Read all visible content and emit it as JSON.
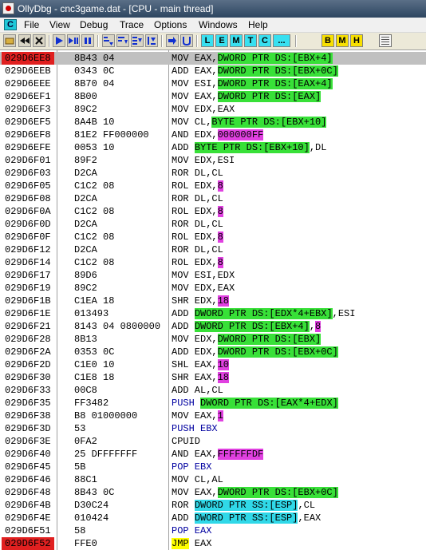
{
  "window": {
    "title": "OllyDbg - cnc3game.dat - [CPU - main thread]"
  },
  "menubar": {
    "sys_icon": "C",
    "items": [
      "File",
      "View",
      "Debug",
      "Trace",
      "Options",
      "Windows",
      "Help"
    ]
  },
  "toolbar": {
    "letter_buttons": [
      "L",
      "E",
      "M",
      "T",
      "C",
      "...",
      "B",
      "M",
      "H"
    ],
    "icons": [
      "open-icon",
      "rewind-icon",
      "close-icon",
      "run-icon",
      "pause-icon",
      "step-into-icon",
      "step-over-icon",
      "trace-into-icon",
      "trace-over-icon",
      "execute-till-return-icon",
      "go-to-user-code-icon",
      "grid-icon"
    ]
  },
  "colors": {
    "memory_operand": "#38e038",
    "immediate_operand": "#e040e0",
    "stack_operand": "#30d8e8",
    "breakpoint_address": "#e02020",
    "selected_row": "#c0c0c0",
    "jump_mnemonic": "#ffff00"
  },
  "disassembly": {
    "rows": [
      {
        "addr": "029D6EE8",
        "hex": "8B43 04",
        "state": "bp-selected",
        "ins": [
          {
            "t": "MOV EAX,"
          },
          {
            "t": "DWORD PTR DS:[EBX+4]",
            "c": "mem"
          }
        ]
      },
      {
        "addr": "029D6EEB",
        "hex": "0343 0C",
        "ins": [
          {
            "t": "ADD EAX,"
          },
          {
            "t": "DWORD PTR DS:[EBX+0C]",
            "c": "mem"
          }
        ]
      },
      {
        "addr": "029D6EEE",
        "hex": "8B70 04",
        "ins": [
          {
            "t": "MOV ESI,"
          },
          {
            "t": "DWORD PTR DS:[EAX+4]",
            "c": "mem"
          }
        ]
      },
      {
        "addr": "029D6EF1",
        "hex": "8B00",
        "ins": [
          {
            "t": "MOV EAX,"
          },
          {
            "t": "DWORD PTR DS:[EAX]",
            "c": "mem"
          }
        ]
      },
      {
        "addr": "029D6EF3",
        "hex": "89C2",
        "ins": [
          {
            "t": "MOV EDX,EAX"
          }
        ]
      },
      {
        "addr": "029D6EF5",
        "hex": "8A4B 10",
        "ins": [
          {
            "t": "MOV CL,"
          },
          {
            "t": "BYTE PTR DS:[EBX+10]",
            "c": "mem"
          }
        ]
      },
      {
        "addr": "029D6EF8",
        "hex": "81E2 FF000000",
        "ins": [
          {
            "t": "AND EDX,"
          },
          {
            "t": "000000FF",
            "c": "imm"
          }
        ]
      },
      {
        "addr": "029D6EFE",
        "hex": "0053 10",
        "ins": [
          {
            "t": "ADD "
          },
          {
            "t": "BYTE PTR DS:[EBX+10]",
            "c": "mem"
          },
          {
            "t": ",DL"
          }
        ]
      },
      {
        "addr": "029D6F01",
        "hex": "89F2",
        "ins": [
          {
            "t": "MOV EDX,ESI"
          }
        ]
      },
      {
        "addr": "029D6F03",
        "hex": "D2CA",
        "ins": [
          {
            "t": "ROR DL,CL"
          }
        ]
      },
      {
        "addr": "029D6F05",
        "hex": "C1C2 08",
        "ins": [
          {
            "t": "ROL EDX,"
          },
          {
            "t": "8",
            "c": "imm"
          }
        ]
      },
      {
        "addr": "029D6F08",
        "hex": "D2CA",
        "ins": [
          {
            "t": "ROR DL,CL"
          }
        ]
      },
      {
        "addr": "029D6F0A",
        "hex": "C1C2 08",
        "ins": [
          {
            "t": "ROL EDX,"
          },
          {
            "t": "8",
            "c": "imm"
          }
        ]
      },
      {
        "addr": "029D6F0D",
        "hex": "D2CA",
        "ins": [
          {
            "t": "ROR DL,CL"
          }
        ]
      },
      {
        "addr": "029D6F0F",
        "hex": "C1C2 08",
        "ins": [
          {
            "t": "ROL EDX,"
          },
          {
            "t": "8",
            "c": "imm"
          }
        ]
      },
      {
        "addr": "029D6F12",
        "hex": "D2CA",
        "ins": [
          {
            "t": "ROR DL,CL"
          }
        ]
      },
      {
        "addr": "029D6F14",
        "hex": "C1C2 08",
        "ins": [
          {
            "t": "ROL EDX,"
          },
          {
            "t": "8",
            "c": "imm"
          }
        ]
      },
      {
        "addr": "029D6F17",
        "hex": "89D6",
        "ins": [
          {
            "t": "MOV ESI,EDX"
          }
        ]
      },
      {
        "addr": "029D6F19",
        "hex": "89C2",
        "ins": [
          {
            "t": "MOV EDX,EAX"
          }
        ]
      },
      {
        "addr": "029D6F1B",
        "hex": "C1EA 18",
        "ins": [
          {
            "t": "SHR EDX,"
          },
          {
            "t": "18",
            "c": "imm"
          }
        ]
      },
      {
        "addr": "029D6F1E",
        "hex": "013493",
        "ins": [
          {
            "t": "ADD "
          },
          {
            "t": "DWORD PTR DS:[EDX*4+EBX]",
            "c": "mem"
          },
          {
            "t": ",ESI"
          }
        ]
      },
      {
        "addr": "029D6F21",
        "hex": "8143 04 0800000",
        "ins": [
          {
            "t": "ADD "
          },
          {
            "t": "DWORD PTR DS:[EBX+4]",
            "c": "mem"
          },
          {
            "t": ","
          },
          {
            "t": "8",
            "c": "imm"
          }
        ]
      },
      {
        "addr": "029D6F28",
        "hex": "8B13",
        "ins": [
          {
            "t": "MOV EDX,"
          },
          {
            "t": "DWORD PTR DS:[EBX]",
            "c": "mem"
          }
        ]
      },
      {
        "addr": "029D6F2A",
        "hex": "0353 0C",
        "ins": [
          {
            "t": "ADD EDX,"
          },
          {
            "t": "DWORD PTR DS:[EBX+0C]",
            "c": "mem"
          }
        ]
      },
      {
        "addr": "029D6F2D",
        "hex": "C1E0 10",
        "ins": [
          {
            "t": "SHL EAX,"
          },
          {
            "t": "10",
            "c": "imm"
          }
        ]
      },
      {
        "addr": "029D6F30",
        "hex": "C1E8 18",
        "ins": [
          {
            "t": "SHR EAX,"
          },
          {
            "t": "18",
            "c": "imm"
          }
        ]
      },
      {
        "addr": "029D6F33",
        "hex": "00C8",
        "ins": [
          {
            "t": "ADD AL,CL"
          }
        ]
      },
      {
        "addr": "029D6F35",
        "hex": "FF3482",
        "ins": [
          {
            "t": "PUSH ",
            "c": "flow"
          },
          {
            "t": "DWORD PTR DS:[EAX*4+EDX]",
            "c": "mem"
          }
        ]
      },
      {
        "addr": "029D6F38",
        "hex": "B8 01000000",
        "ins": [
          {
            "t": "MOV EAX,"
          },
          {
            "t": "1",
            "c": "imm"
          }
        ]
      },
      {
        "addr": "029D6F3D",
        "hex": "53",
        "ins": [
          {
            "t": "PUSH EBX",
            "c": "flow"
          }
        ]
      },
      {
        "addr": "029D6F3E",
        "hex": "0FA2",
        "ins": [
          {
            "t": "CPUID"
          }
        ]
      },
      {
        "addr": "029D6F40",
        "hex": "25 DFFFFFFF",
        "ins": [
          {
            "t": "AND EAX,"
          },
          {
            "t": "FFFFFFDF",
            "c": "imm"
          }
        ]
      },
      {
        "addr": "029D6F45",
        "hex": "5B",
        "ins": [
          {
            "t": "POP EBX",
            "c": "flow"
          }
        ]
      },
      {
        "addr": "029D6F46",
        "hex": "88C1",
        "ins": [
          {
            "t": "MOV CL,AL"
          }
        ]
      },
      {
        "addr": "029D6F48",
        "hex": "8B43 0C",
        "ins": [
          {
            "t": "MOV EAX,"
          },
          {
            "t": "DWORD PTR DS:[EBX+0C]",
            "c": "mem"
          }
        ]
      },
      {
        "addr": "029D6F4B",
        "hex": "D30C24",
        "ins": [
          {
            "t": "ROR "
          },
          {
            "t": "DWORD PTR SS:[ESP]",
            "c": "stk"
          },
          {
            "t": ",CL"
          }
        ]
      },
      {
        "addr": "029D6F4E",
        "hex": "010424",
        "ins": [
          {
            "t": "ADD "
          },
          {
            "t": "DWORD PTR SS:[ESP]",
            "c": "stk"
          },
          {
            "t": ",EAX"
          }
        ]
      },
      {
        "addr": "029D6F51",
        "hex": "58",
        "ins": [
          {
            "t": "POP EAX",
            "c": "flow"
          }
        ]
      },
      {
        "addr": "029D6F52",
        "hex": "FFE0",
        "state": "bp",
        "ins": [
          {
            "t": "JMP",
            "c": "jmp"
          },
          {
            "t": " EAX"
          }
        ]
      }
    ]
  }
}
